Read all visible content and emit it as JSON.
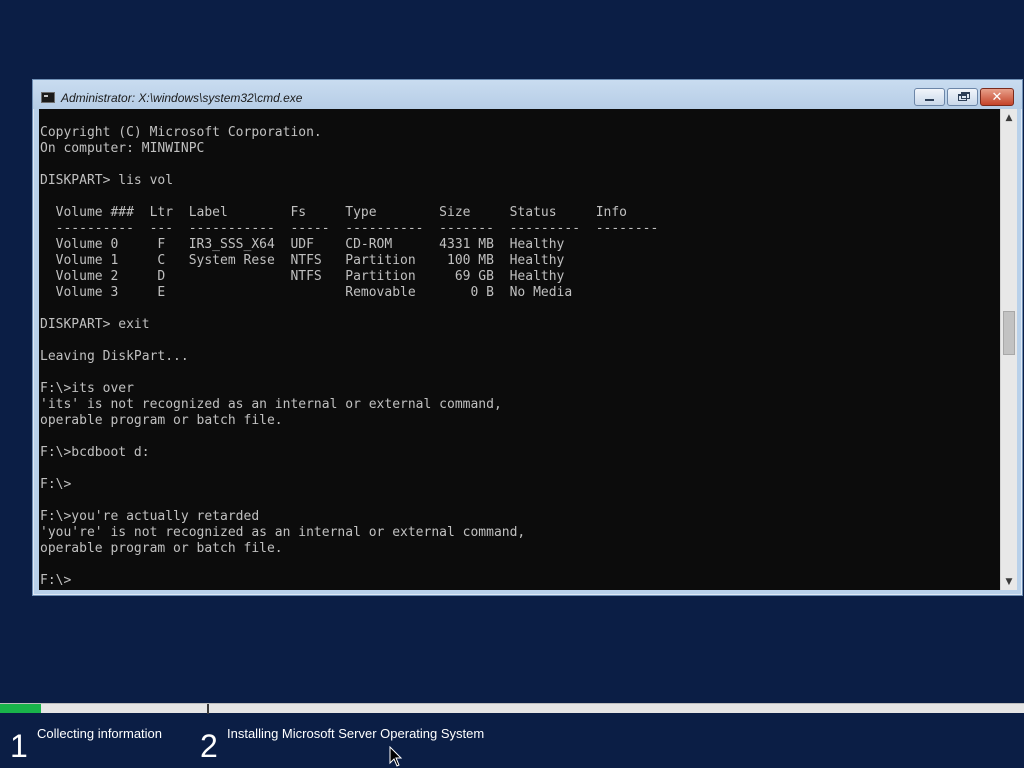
{
  "window": {
    "title": "Administrator: X:\\windows\\system32\\cmd.exe",
    "controls": {
      "minimize_icon": "minimize-icon",
      "maximize_icon": "restore-icon",
      "close_icon": "close-icon",
      "close_glyph": "✕"
    }
  },
  "console": {
    "lines": [
      "Copyright (C) Microsoft Corporation.",
      "On computer: MINWINPC",
      "",
      "DISKPART> lis vol",
      "",
      "  Volume ###  Ltr  Label        Fs     Type        Size     Status     Info",
      "  ----------  ---  -----------  -----  ----------  -------  ---------  --------",
      "  Volume 0     F   IR3_SSS_X64  UDF    CD-ROM      4331 MB  Healthy",
      "  Volume 1     C   System Rese  NTFS   Partition    100 MB  Healthy",
      "  Volume 2     D                NTFS   Partition     69 GB  Healthy",
      "  Volume 3     E                       Removable       0 B  No Media",
      "",
      "DISKPART> exit",
      "",
      "Leaving DiskPart...",
      "",
      "F:\\>its over",
      "'its' is not recognized as an internal or external command,",
      "operable program or batch file.",
      "",
      "F:\\>bcdboot d:",
      "",
      "F:\\>",
      "",
      "F:\\>you're actually retarded",
      "'you're' is not recognized as an internal or external command,",
      "operable program or batch file.",
      "",
      "F:\\>"
    ]
  },
  "scrollbar": {
    "up_arrow": "▲",
    "down_arrow": "▼"
  },
  "setup_progress": {
    "fill_fraction": 0.04,
    "fill_color": "#19b34a",
    "steps": [
      {
        "number": "1",
        "label": "Collecting information"
      },
      {
        "number": "2",
        "label": "Installing Microsoft Server Operating System"
      }
    ]
  },
  "colors": {
    "desktop_bg": "#0b1e45",
    "console_bg": "#0c0c0c",
    "console_text": "#c0c0c0"
  }
}
